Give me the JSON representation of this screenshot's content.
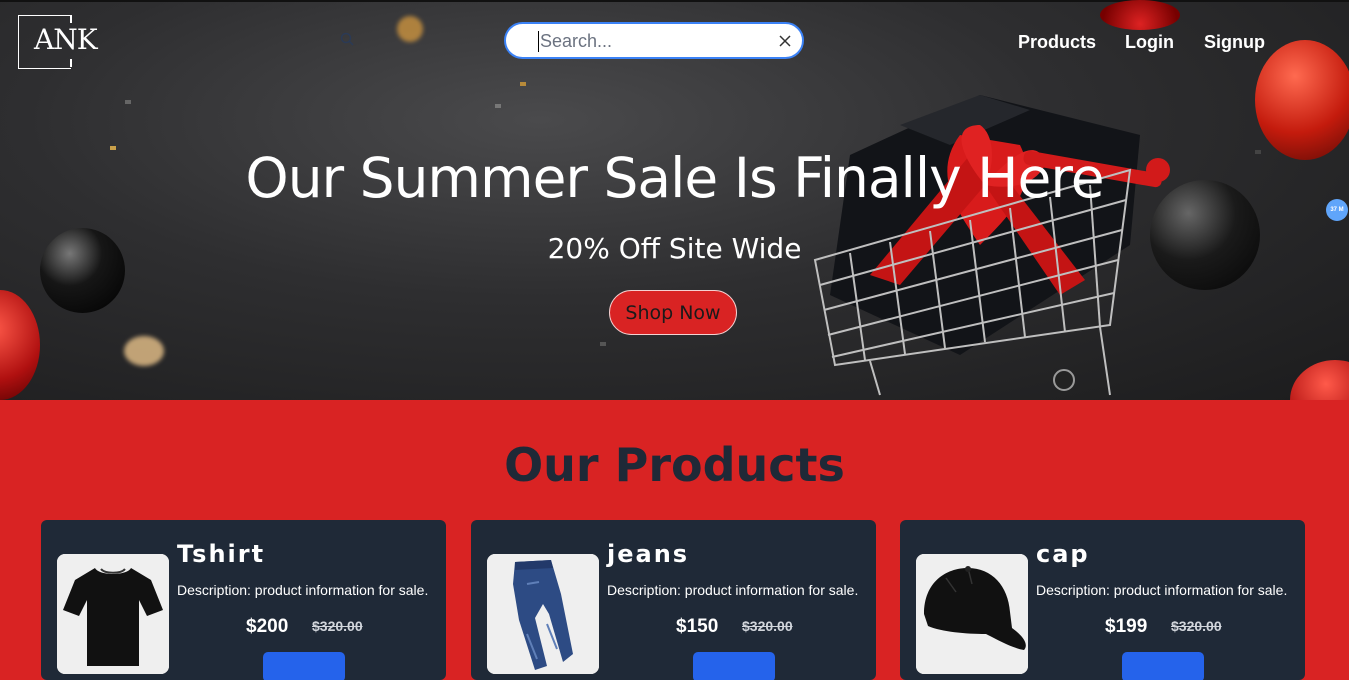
{
  "brand": {
    "logo_text": "ANK"
  },
  "search": {
    "placeholder": "Search...",
    "value": ""
  },
  "nav": {
    "items": [
      {
        "label": "Products"
      },
      {
        "label": "Login"
      },
      {
        "label": "Signup"
      }
    ]
  },
  "hero": {
    "title": "Our Summer Sale Is Finally Here",
    "subtitle": "20% Off Site Wide",
    "cta_label": "Shop Now"
  },
  "floating_badge": {
    "text": "37 M"
  },
  "products": {
    "section_title": "Our Products",
    "items": [
      {
        "name": "Tshirt",
        "description": "Description: product information for sale.",
        "price": "$200",
        "old_price": "$320.00",
        "icon": "tshirt-icon"
      },
      {
        "name": "jeans",
        "description": "Description: product information for sale.",
        "price": "$150",
        "old_price": "$320.00",
        "icon": "jeans-icon"
      },
      {
        "name": "cap",
        "description": "Description: product information for sale.",
        "price": "$199",
        "old_price": "$320.00",
        "icon": "cap-icon"
      }
    ]
  },
  "colors": {
    "accent": "#d92323",
    "card": "#1f2937",
    "button": "#2563eb",
    "search_border": "#3b82f6"
  }
}
